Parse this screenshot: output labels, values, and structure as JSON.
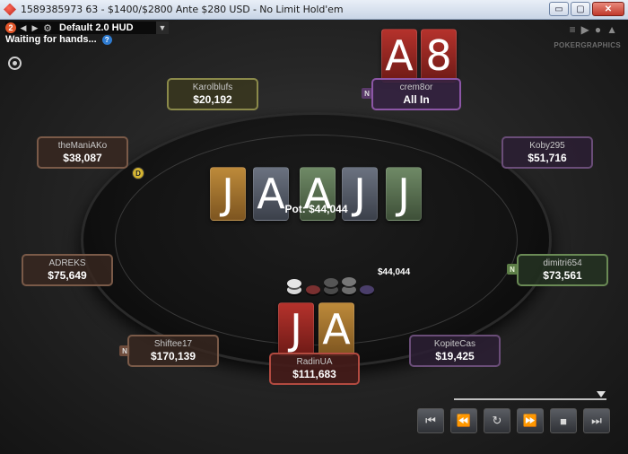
{
  "window": {
    "title": "1589385973 63 - $1400/$2800 Ante $280 USD - No Limit Hold'em",
    "controls": [
      "▭",
      "▢",
      "✕"
    ]
  },
  "hud": {
    "badge": "2",
    "label": "Default 2.0 HUD",
    "status": "Waiting for hands..."
  },
  "branding": {
    "logo": "POKERGRAPHICS"
  },
  "board": {
    "cards": [
      {
        "rank": "J",
        "suit": "diamond"
      },
      {
        "rank": "A",
        "suit": "spade"
      },
      {
        "rank": "A",
        "suit": "club"
      },
      {
        "rank": "J",
        "suit": "spade"
      },
      {
        "rank": "J",
        "suit": "club"
      }
    ],
    "pot": "Pot: $44,044"
  },
  "chips": {
    "amount": "$44,044"
  },
  "seats": [
    {
      "name": "Karolblufs",
      "stack": "$20,192"
    },
    {
      "name": "crem8or",
      "stack": "All In",
      "cards": [
        "A",
        "8"
      ],
      "badge": "N"
    },
    {
      "name": "theManiAKo",
      "stack": "$38,087"
    },
    {
      "name": "Koby295",
      "stack": "$51,716"
    },
    {
      "name": "ADREKS",
      "stack": "$75,649"
    },
    {
      "name": "dimitri654",
      "stack": "$73,561",
      "badge": "N"
    },
    {
      "name": "Shiftee17",
      "stack": "$170,139",
      "badge": "N"
    },
    {
      "name": "RadinUA",
      "stack": "$111,683",
      "cards": [
        "J",
        "A"
      ]
    },
    {
      "name": "KopiteCas",
      "stack": "$19,425"
    }
  ],
  "dealer_button": "D",
  "colors": {
    "accent_diamond": "#bd8a3a",
    "accent_club": "#6f8a66",
    "accent_spade": "#6b7280",
    "accent_heart": "#b5322c"
  },
  "replay_controls": [
    "previous-hand",
    "rewind",
    "replay",
    "fast-forward",
    "stop",
    "next-hand"
  ]
}
